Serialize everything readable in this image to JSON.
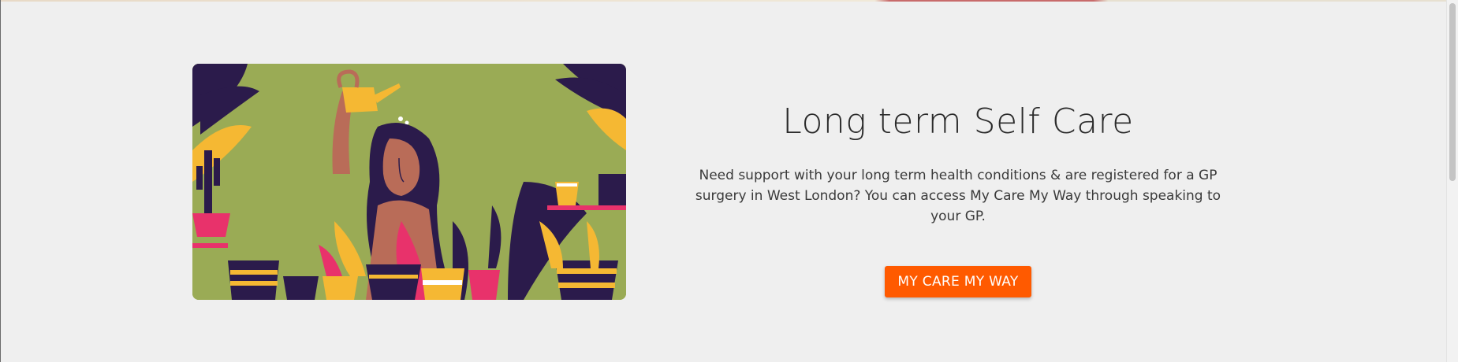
{
  "hero": {
    "title": "Long term Self Care",
    "description": "Need support with your long term health conditions & are registered for a GP surgery in West London? You can access My Care My Way through speaking to your GP.",
    "cta_label": "MY CARE MY WAY",
    "image_alt": "illustration-woman-watering-plants"
  },
  "colors": {
    "background": "#efefef",
    "cta": "#ff5a00",
    "illustration_bg": "#9aab55",
    "ink": "#2b1b4b",
    "accent_yellow": "#f5b833",
    "accent_pink": "#e8326b",
    "skin": "#b96c58"
  }
}
